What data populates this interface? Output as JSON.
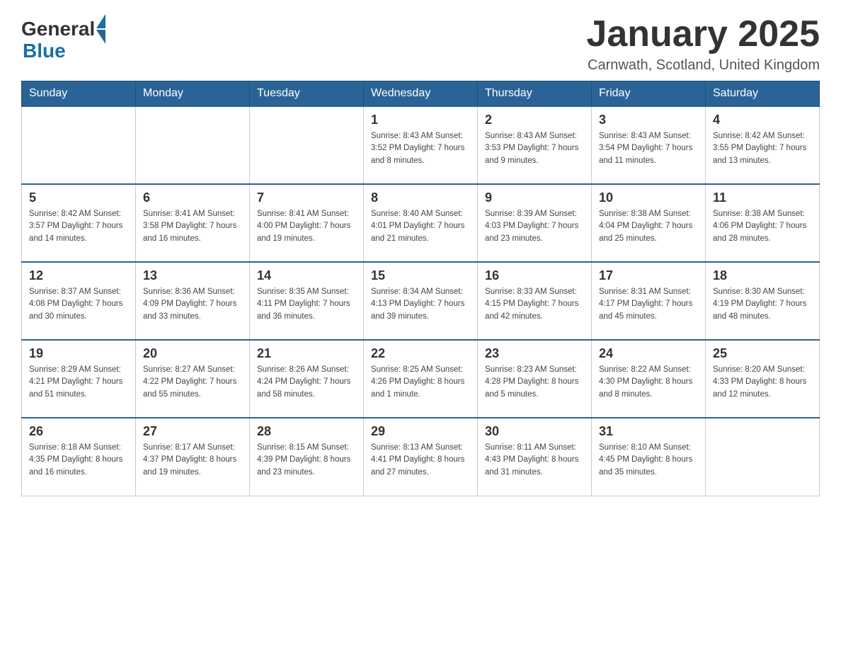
{
  "header": {
    "logo_general": "General",
    "logo_blue": "Blue",
    "month_title": "January 2025",
    "location": "Carnwath, Scotland, United Kingdom"
  },
  "weekdays": [
    "Sunday",
    "Monday",
    "Tuesday",
    "Wednesday",
    "Thursday",
    "Friday",
    "Saturday"
  ],
  "weeks": [
    [
      {
        "day": "",
        "info": ""
      },
      {
        "day": "",
        "info": ""
      },
      {
        "day": "",
        "info": ""
      },
      {
        "day": "1",
        "info": "Sunrise: 8:43 AM\nSunset: 3:52 PM\nDaylight: 7 hours and 8 minutes."
      },
      {
        "day": "2",
        "info": "Sunrise: 8:43 AM\nSunset: 3:53 PM\nDaylight: 7 hours and 9 minutes."
      },
      {
        "day": "3",
        "info": "Sunrise: 8:43 AM\nSunset: 3:54 PM\nDaylight: 7 hours and 11 minutes."
      },
      {
        "day": "4",
        "info": "Sunrise: 8:42 AM\nSunset: 3:55 PM\nDaylight: 7 hours and 13 minutes."
      }
    ],
    [
      {
        "day": "5",
        "info": "Sunrise: 8:42 AM\nSunset: 3:57 PM\nDaylight: 7 hours and 14 minutes."
      },
      {
        "day": "6",
        "info": "Sunrise: 8:41 AM\nSunset: 3:58 PM\nDaylight: 7 hours and 16 minutes."
      },
      {
        "day": "7",
        "info": "Sunrise: 8:41 AM\nSunset: 4:00 PM\nDaylight: 7 hours and 19 minutes."
      },
      {
        "day": "8",
        "info": "Sunrise: 8:40 AM\nSunset: 4:01 PM\nDaylight: 7 hours and 21 minutes."
      },
      {
        "day": "9",
        "info": "Sunrise: 8:39 AM\nSunset: 4:03 PM\nDaylight: 7 hours and 23 minutes."
      },
      {
        "day": "10",
        "info": "Sunrise: 8:38 AM\nSunset: 4:04 PM\nDaylight: 7 hours and 25 minutes."
      },
      {
        "day": "11",
        "info": "Sunrise: 8:38 AM\nSunset: 4:06 PM\nDaylight: 7 hours and 28 minutes."
      }
    ],
    [
      {
        "day": "12",
        "info": "Sunrise: 8:37 AM\nSunset: 4:08 PM\nDaylight: 7 hours and 30 minutes."
      },
      {
        "day": "13",
        "info": "Sunrise: 8:36 AM\nSunset: 4:09 PM\nDaylight: 7 hours and 33 minutes."
      },
      {
        "day": "14",
        "info": "Sunrise: 8:35 AM\nSunset: 4:11 PM\nDaylight: 7 hours and 36 minutes."
      },
      {
        "day": "15",
        "info": "Sunrise: 8:34 AM\nSunset: 4:13 PM\nDaylight: 7 hours and 39 minutes."
      },
      {
        "day": "16",
        "info": "Sunrise: 8:33 AM\nSunset: 4:15 PM\nDaylight: 7 hours and 42 minutes."
      },
      {
        "day": "17",
        "info": "Sunrise: 8:31 AM\nSunset: 4:17 PM\nDaylight: 7 hours and 45 minutes."
      },
      {
        "day": "18",
        "info": "Sunrise: 8:30 AM\nSunset: 4:19 PM\nDaylight: 7 hours and 48 minutes."
      }
    ],
    [
      {
        "day": "19",
        "info": "Sunrise: 8:29 AM\nSunset: 4:21 PM\nDaylight: 7 hours and 51 minutes."
      },
      {
        "day": "20",
        "info": "Sunrise: 8:27 AM\nSunset: 4:22 PM\nDaylight: 7 hours and 55 minutes."
      },
      {
        "day": "21",
        "info": "Sunrise: 8:26 AM\nSunset: 4:24 PM\nDaylight: 7 hours and 58 minutes."
      },
      {
        "day": "22",
        "info": "Sunrise: 8:25 AM\nSunset: 4:26 PM\nDaylight: 8 hours and 1 minute."
      },
      {
        "day": "23",
        "info": "Sunrise: 8:23 AM\nSunset: 4:28 PM\nDaylight: 8 hours and 5 minutes."
      },
      {
        "day": "24",
        "info": "Sunrise: 8:22 AM\nSunset: 4:30 PM\nDaylight: 8 hours and 8 minutes."
      },
      {
        "day": "25",
        "info": "Sunrise: 8:20 AM\nSunset: 4:33 PM\nDaylight: 8 hours and 12 minutes."
      }
    ],
    [
      {
        "day": "26",
        "info": "Sunrise: 8:18 AM\nSunset: 4:35 PM\nDaylight: 8 hours and 16 minutes."
      },
      {
        "day": "27",
        "info": "Sunrise: 8:17 AM\nSunset: 4:37 PM\nDaylight: 8 hours and 19 minutes."
      },
      {
        "day": "28",
        "info": "Sunrise: 8:15 AM\nSunset: 4:39 PM\nDaylight: 8 hours and 23 minutes."
      },
      {
        "day": "29",
        "info": "Sunrise: 8:13 AM\nSunset: 4:41 PM\nDaylight: 8 hours and 27 minutes."
      },
      {
        "day": "30",
        "info": "Sunrise: 8:11 AM\nSunset: 4:43 PM\nDaylight: 8 hours and 31 minutes."
      },
      {
        "day": "31",
        "info": "Sunrise: 8:10 AM\nSunset: 4:45 PM\nDaylight: 8 hours and 35 minutes."
      },
      {
        "day": "",
        "info": ""
      }
    ]
  ]
}
